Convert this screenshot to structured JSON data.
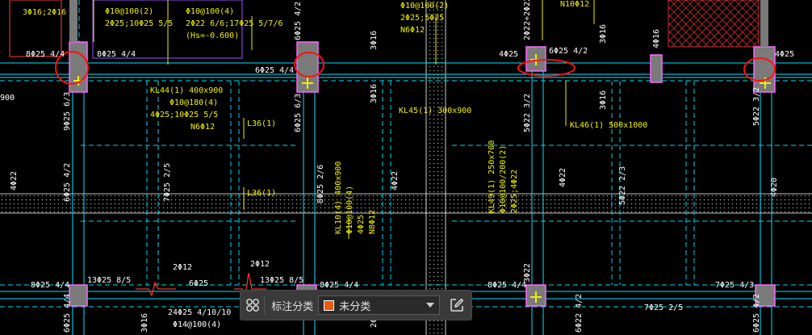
{
  "toolbar": {
    "grid_icon": "grid-four-circles-icon",
    "label": "标注分类",
    "selected_category": "未分类",
    "category_color": "#e85a0c",
    "edit_icon": "edit-pencil-icon"
  },
  "drawing": {
    "beam_labels": [
      "KL44(1) 400x900",
      "Φ10@180(4)",
      "4Φ25;10Φ25 5/5",
      "N6Φ12",
      "KL45(1) 300x900",
      "KL46(1) 500x1000",
      "KL10(4) 400x900",
      "Φ10@100(4)",
      "4Φ25",
      "N8Φ12",
      "KL49(1) 250x700",
      "Φ10@100/200(2)",
      "2Φ25;4Φ22",
      "Φ10@100(2)",
      "2Φ25;5Φ25",
      "N6Φ12",
      "Φ10@100(2)",
      "2Φ25;10Φ25 5/5",
      "Φ10@100(4)",
      "2Φ22 6/6;17Φ25 5/7/6",
      "(Hs=-0.600)",
      "3Φ16;2Φ16",
      "L36(1)",
      "L36(1)",
      "N10Φ12"
    ],
    "rebar_labels": [
      "8Φ25 4/4",
      "8Φ25 4/4",
      "6Φ25 4/2",
      "6Φ25 4/4",
      "4Φ25",
      "6Φ25 4/2",
      "4Φ25",
      "2Φ22+2Φ22",
      "3Φ16",
      "3Φ16",
      "4Φ16",
      "3Φ16",
      "3Φ16",
      "9Φ25 6/3",
      "6Φ25 6/3",
      "5Φ22 3/2",
      "5Φ22 3/2",
      "6Φ25 4/2",
      "4Φ22",
      "4Φ22",
      "7Φ25 2/5",
      "4Φ22",
      "5Φ22 2/3",
      "4Φ20",
      "8Φ25 2/6",
      "8Φ25 4/4",
      "13Φ25 8/5",
      "13Φ25 8/5",
      "8Φ25 4/4",
      "8Φ25 4/4",
      "7Φ25 4/3",
      "7Φ25 2/5",
      "24Φ25 4/10/10",
      "Φ14@100(4)",
      "2Φ12",
      "2Φ12",
      "6Φ25",
      "2Φ12",
      "3Φ22",
      "6Φ22 4/2",
      "6Φ25 4/2",
      "6Φ25 4/4",
      "3Φ16",
      "900"
    ]
  }
}
